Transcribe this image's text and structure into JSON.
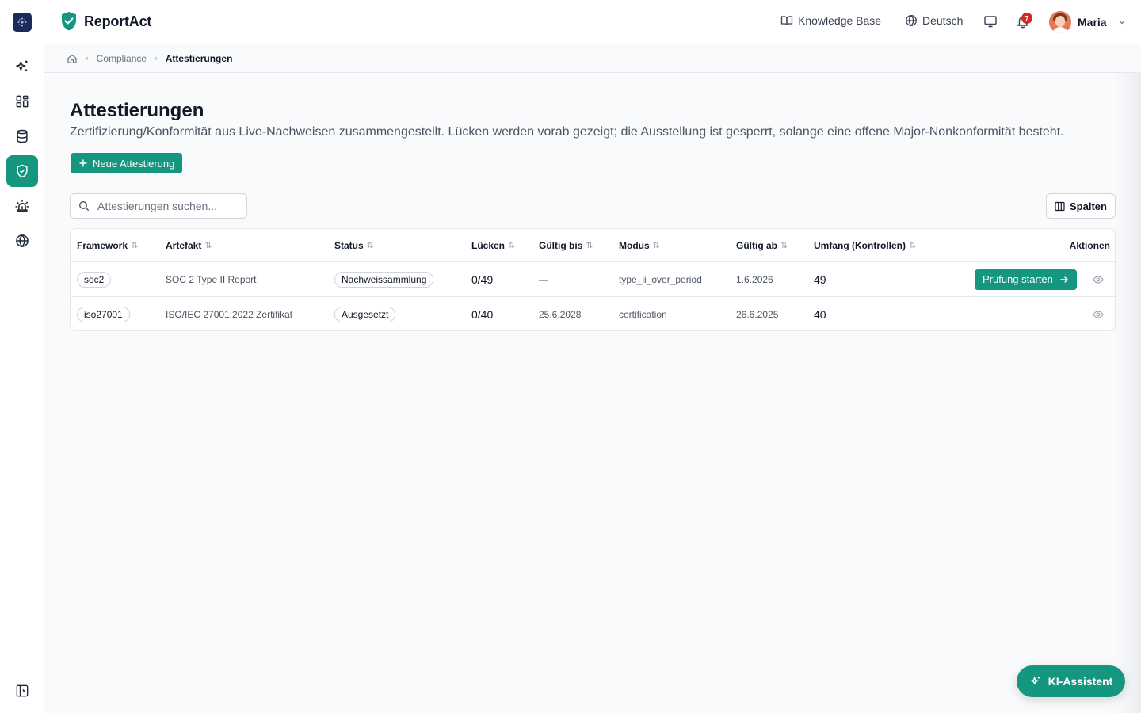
{
  "brand": {
    "name": "ReportAct",
    "logo_icon": "shield-check-icon",
    "accent": "#14967f"
  },
  "header": {
    "knowledge_base": "Knowledge Base",
    "language": "Deutsch",
    "notifications_count": "7",
    "user_name": "Maria"
  },
  "rail": {
    "items": [
      {
        "icon": "sparkles-icon",
        "active": false
      },
      {
        "icon": "dashboard-grid-icon",
        "active": false
      },
      {
        "icon": "database-icon",
        "active": false
      },
      {
        "icon": "shield-check-icon",
        "active": true
      },
      {
        "icon": "alarm-siren-icon",
        "active": false
      },
      {
        "icon": "globe-icon",
        "active": false
      }
    ],
    "collapse_icon": "sidebar-toggle-icon"
  },
  "breadcrumb": {
    "home_icon": "home-icon",
    "section": "Compliance",
    "current": "Attestierungen"
  },
  "page": {
    "title": "Attestierungen",
    "description": "Zertifizierung/Konformität aus Live-Nachweisen zusammengestellt. Lücken werden vorab gezeigt; die Ausstellung ist gesperrt, solange eine offene Major-Nonkonformität besteht.",
    "new_button": "Neue Attestierung",
    "search_placeholder": "Attestierungen suchen...",
    "columns_button": "Spalten"
  },
  "table": {
    "headers": {
      "framework": "Framework",
      "artefakt": "Artefakt",
      "status": "Status",
      "luecken": "Lücken",
      "gueltig_bis": "Gültig bis",
      "modus": "Modus",
      "gueltig_ab": "Gültig ab",
      "umfang": "Umfang (Kontrollen)",
      "aktionen": "Aktionen"
    },
    "rows": [
      {
        "framework": "soc2",
        "artefakt": "SOC 2 Type II Report",
        "status": "Nachweissammlung",
        "luecken": "0/49",
        "gueltig_bis": "—",
        "modus": "type_ii_over_period",
        "gueltig_ab": "1.6.2026",
        "umfang": "49",
        "action": "Prüfung starten"
      },
      {
        "framework": "iso27001",
        "artefakt": "ISO/IEC 27001:2022 Zertifikat",
        "status": "Ausgesetzt",
        "luecken": "0/40",
        "gueltig_bis": "25.6.2028",
        "modus": "certification",
        "gueltig_ab": "26.6.2025",
        "umfang": "40",
        "action": ""
      }
    ]
  },
  "assistant": {
    "label": "KI-Assistent"
  }
}
